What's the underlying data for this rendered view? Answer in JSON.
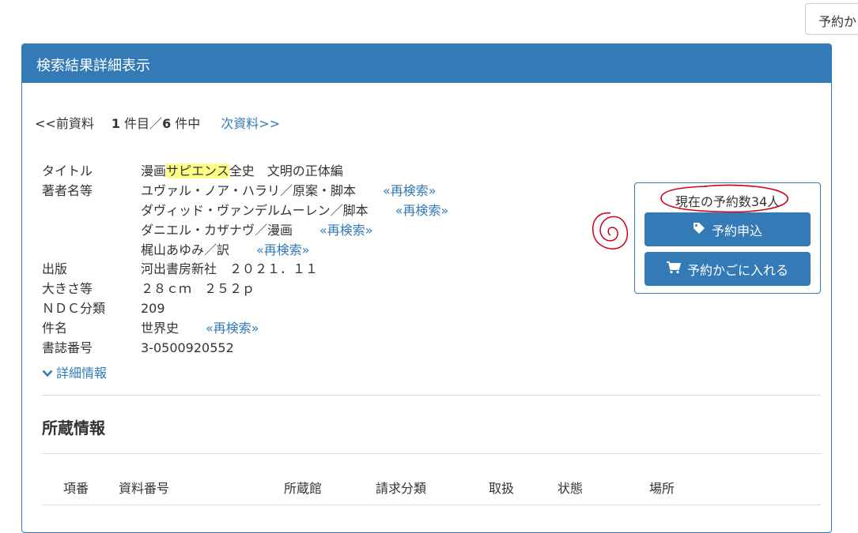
{
  "top_button": {
    "label": "予約かご"
  },
  "panel": {
    "title": "検索結果詳細表示"
  },
  "pager": {
    "prev": "<<前資料",
    "current": "1",
    "current_suffix": " 件目／",
    "total": "6",
    "total_suffix": " 件中",
    "next": "次資料>>"
  },
  "record": {
    "title_label": "タイトル",
    "title_before": "漫画",
    "title_highlight": "サピエンス",
    "title_after": "全史　文明の正体編",
    "author_label": "著者名等",
    "authors": [
      {
        "name": "ユヴァル・ノア・ハラリ／原案・脚本",
        "link": "«再検索»"
      },
      {
        "name": "ダヴィッド・ヴァンデルムーレン／脚本",
        "link": "«再検索»"
      },
      {
        "name": "ダニエル・カザナヴ／漫画",
        "link": "«再検索»"
      },
      {
        "name": "梶山あゆみ／訳",
        "link": "«再検索»"
      }
    ],
    "publisher_label": "出版",
    "publisher": "河出書房新社　２０２１．１１",
    "size_label": "大きさ等",
    "size": "２８ｃｍ　２５２ｐ",
    "ndc_label": "ＮＤＣ分類",
    "ndc": "209",
    "subject_label": "件名",
    "subject": "世界史",
    "subject_link": "«再検索»",
    "bib_label": "書誌番号",
    "bib": "3-0500920552"
  },
  "detail_link": "詳細情報",
  "holdings": {
    "title": "所蔵情報",
    "columns": [
      "項番",
      "資料番号",
      "所蔵館",
      "請求分類",
      "取扱",
      "状態",
      "場所"
    ]
  },
  "reserve": {
    "count_text": "現在の予約数34人",
    "apply_label": "予約申込",
    "cart_label": "予約かごに入れる"
  },
  "colors": {
    "accent": "#337ab7",
    "highlight": "#ffff88",
    "annotation": "#d0021b"
  }
}
